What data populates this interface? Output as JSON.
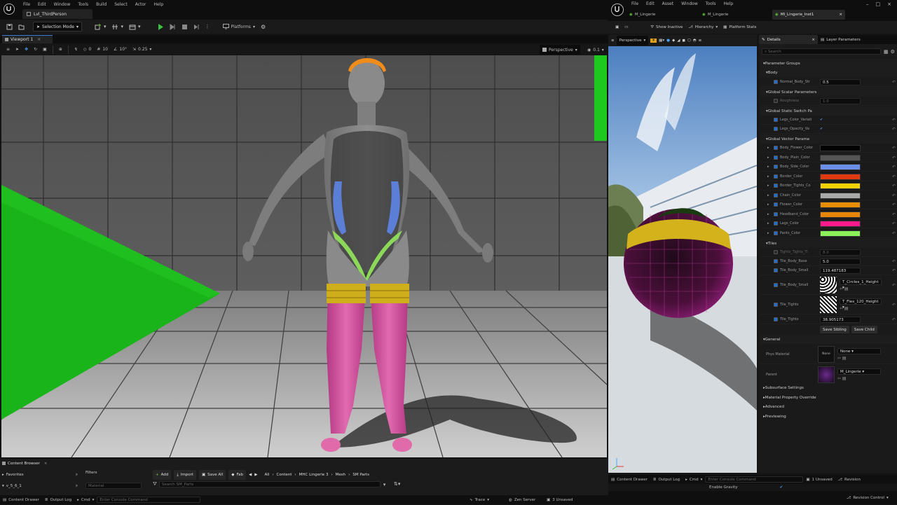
{
  "left_menu": [
    "File",
    "Edit",
    "Window",
    "Tools",
    "Build",
    "Select",
    "Actor",
    "Help"
  ],
  "level_tab": "Lvl_ThirdPerson",
  "selection_mode": "Selection Mode",
  "platforms": "Platforms",
  "viewport_tab": "Viewport 1",
  "vp_values": {
    "rot": "0",
    "snap": "10",
    "angle": "10°",
    "scale": "0.25",
    "perspective": "Perspective",
    "speed": "0.1"
  },
  "content_browser": {
    "tab": "Content Browser",
    "favorites": "Favorites",
    "folder": "v_5_6_1",
    "filters": "Filters",
    "material_filter": "Material",
    "add": "Add",
    "import": "Import",
    "save_all": "Save All",
    "fab": "Fab",
    "path": [
      "All",
      "Content",
      "MHC Lingerie 3",
      "Mesh",
      "SM Parts"
    ],
    "search_placeholder": "Search SM_Parts"
  },
  "bottom_bar": {
    "content_drawer": "Content Drawer",
    "output_log": "Output Log",
    "cmd": "Cmd",
    "console_placeholder": "Enter Console Command",
    "trace": "Trace",
    "zen": "Zen Server",
    "unsaved": "3 Unsaved",
    "revision": "Revision Control"
  },
  "right_menu": [
    "File",
    "Edit",
    "Asset",
    "Window",
    "Tools",
    "Help"
  ],
  "right_tabs": [
    "M_Lingerie",
    "M_Lingerie",
    "MI_Lingerie_Inst1"
  ],
  "right_toolbar": {
    "show_inactive": "Show Inactive",
    "hierarchy": "Hierarchy",
    "platform_stats": "Platform Stats"
  },
  "preview": {
    "perspective": "Perspective"
  },
  "details": {
    "tab": "Details",
    "layer_tab": "Layer Parameters",
    "search_placeholder": "Search",
    "parameter_groups": "Parameter Groups",
    "groups": {
      "body": "Body",
      "scalar": "Global Scalar Parameters",
      "static_switch": "Global Static Switch Pa",
      "vector": "Global Vector Parame",
      "tiles": "Tiles",
      "general": "General"
    },
    "body_param": {
      "name": "Normal_Body_Str",
      "value": "0.5"
    },
    "scalar_param": {
      "name": "Roughness",
      "value": "1.0"
    },
    "switch_params": [
      "Legs_Color_Variati",
      "Legs_Opacity_Va"
    ],
    "vector_params": [
      {
        "name": "Body_Flower_Color",
        "color": "#000000"
      },
      {
        "name": "Body_Plain_Color",
        "color": "#555555"
      },
      {
        "name": "Body_Side_Color",
        "color": "#6b8fe6"
      },
      {
        "name": "Border_Color",
        "color": "#e23a10"
      },
      {
        "name": "Border_Tights_Co",
        "color": "#f2d200"
      },
      {
        "name": "Chain_Color",
        "color": "#a8a8a8"
      },
      {
        "name": "Flower_Color",
        "color": "#e58c00"
      },
      {
        "name": "Headband_Color",
        "color": "#e8860a"
      },
      {
        "name": "Legs_Color",
        "color": "#ff1a8c"
      },
      {
        "name": "Pants_Color",
        "color": "#8cf25a"
      }
    ],
    "tile_params": [
      {
        "name": "Tights_Tights_Ti",
        "value": "8.0"
      },
      {
        "name": "Tile_Body_Base",
        "value": "5.0"
      },
      {
        "name": "Tile_Body_Small",
        "value": "119.487183"
      }
    ],
    "tex_params": [
      {
        "name": "Tile_Body_Small",
        "value": "T_Circles_1_Height"
      },
      {
        "name": "Tile_Tights",
        "value": "T_Flex_120_Height"
      }
    ],
    "tile_tights": {
      "name": "Tile_Tights",
      "value": "38.905173"
    },
    "save_sibling": "Save Sibling",
    "save_child": "Save Child",
    "phys_material": {
      "label": "Phys Material",
      "value": "None",
      "thumb": "None"
    },
    "parent": {
      "label": "Parent",
      "value": "M_Lingerie"
    },
    "sections": [
      "Subsurface Settings",
      "Material Property Override",
      "Advanced",
      "Previewing"
    ]
  },
  "right_bottom": {
    "content_drawer": "Content Drawer",
    "output_log": "Output Log",
    "cmd": "Cmd",
    "console_placeholder": "Enter Console Command",
    "unsaved": "1 Unsaved",
    "revision": "Revision",
    "enable_gravity": "Enable Gravity"
  }
}
